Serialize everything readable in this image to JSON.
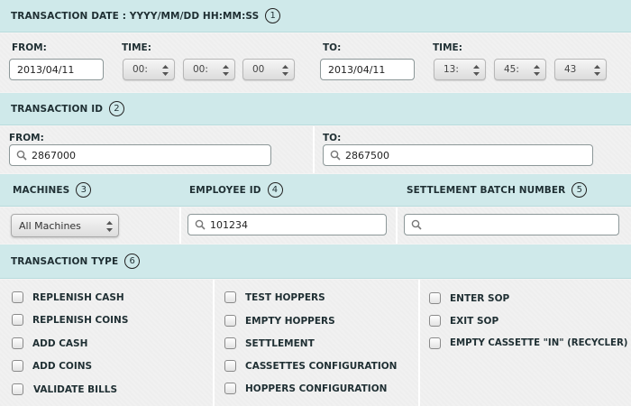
{
  "sections": {
    "date": {
      "title": "TRANSACTION DATE : YYYY/MM/DD HH:MM:SS",
      "num": "1"
    },
    "id": {
      "title": "TRANSACTION ID",
      "num": "2"
    },
    "machines": {
      "title": "MACHINES",
      "num": "3"
    },
    "employee": {
      "title": "EMPLOYEE ID",
      "num": "4"
    },
    "batch": {
      "title": "SETTLEMENT BATCH NUMBER",
      "num": "5"
    },
    "type": {
      "title": "TRANSACTION TYPE",
      "num": "6"
    }
  },
  "date_range": {
    "from_label": "FROM:",
    "from_value": "2013/04/11",
    "from_time_label": "TIME:",
    "from_hour": "00:",
    "from_minute": "00:",
    "from_second": "00",
    "to_label": "TO:",
    "to_value": "2013/04/11",
    "to_time_label": "TIME:",
    "to_hour": "13:",
    "to_minute": "45:",
    "to_second": "43"
  },
  "id_range": {
    "from_label": "FROM:",
    "from_value": "2867000",
    "to_label": "TO:",
    "to_value": "2867500"
  },
  "machines_select": {
    "value": "All Machines"
  },
  "employee_input": {
    "value": "101234"
  },
  "batch_input": {
    "value": ""
  },
  "transaction_types": {
    "col1": [
      "REPLENISH CASH",
      "REPLENISH COINS",
      "ADD CASH",
      "ADD COINS",
      "VALIDATE BILLS"
    ],
    "col2": [
      "TEST HOPPERS",
      "EMPTY HOPPERS",
      "SETTLEMENT",
      "CASSETTES CONFIGURATION",
      "HOPPERS CONFIGURATION"
    ],
    "col3": [
      "ENTER SOP",
      "EXIT SOP",
      "EMPTY CASSETTE \"IN\" (RECYCLER)"
    ]
  }
}
